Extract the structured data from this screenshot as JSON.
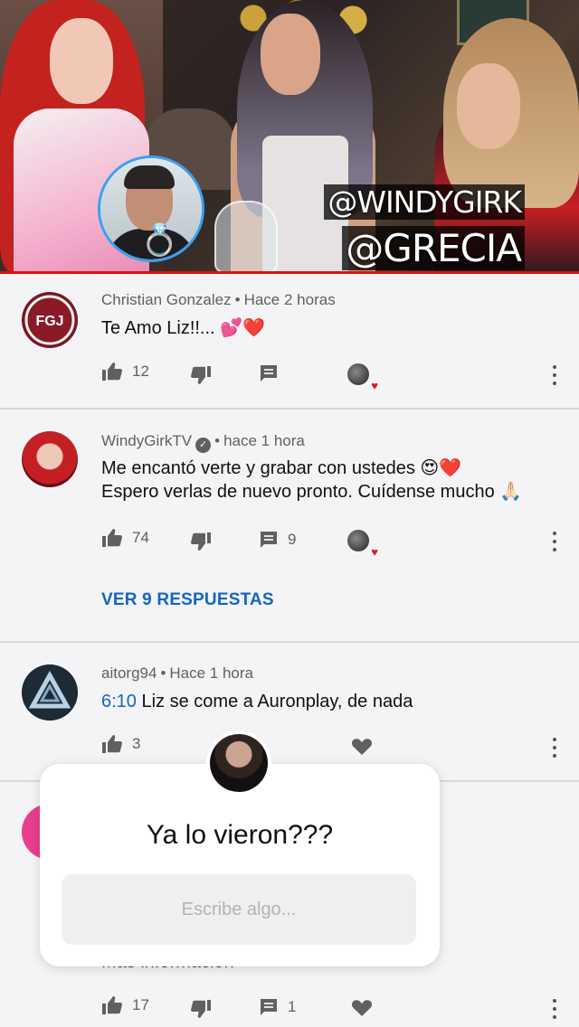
{
  "video": {
    "tags": [
      "@WINDYGIRK",
      "@GRECIA"
    ],
    "accent_color": "#dd1111"
  },
  "comments": [
    {
      "author": "Christian Gonzalez",
      "time": "Hace 2 horas",
      "text": "Te Amo Liz!!... 💕❤️",
      "likes": "12",
      "reply_count": "",
      "avatar_text": "FGJ"
    },
    {
      "author": "WindyGirkTV",
      "verified": true,
      "time": "hace 1 hora",
      "text_line1": "Me encantó verte y grabar con ustedes 😍❤️",
      "text_line2": "Espero verlas de nuevo pronto. Cuídense mucho 🙏🏻",
      "likes": "74",
      "reply_count": "9",
      "view_replies": "VER 9 RESPUESTAS"
    },
    {
      "author": "aitorg94",
      "time": "Hace 1 hora",
      "timestamp_link": "6:10",
      "text": " Liz se come a Auronplay, de nada",
      "likes": "3"
    },
    {
      "partial_text": "Más información",
      "likes": "17",
      "reply_count": "1"
    }
  ],
  "sticker": {
    "question": "Ya lo vieron???",
    "placeholder": "Escribe algo..."
  }
}
